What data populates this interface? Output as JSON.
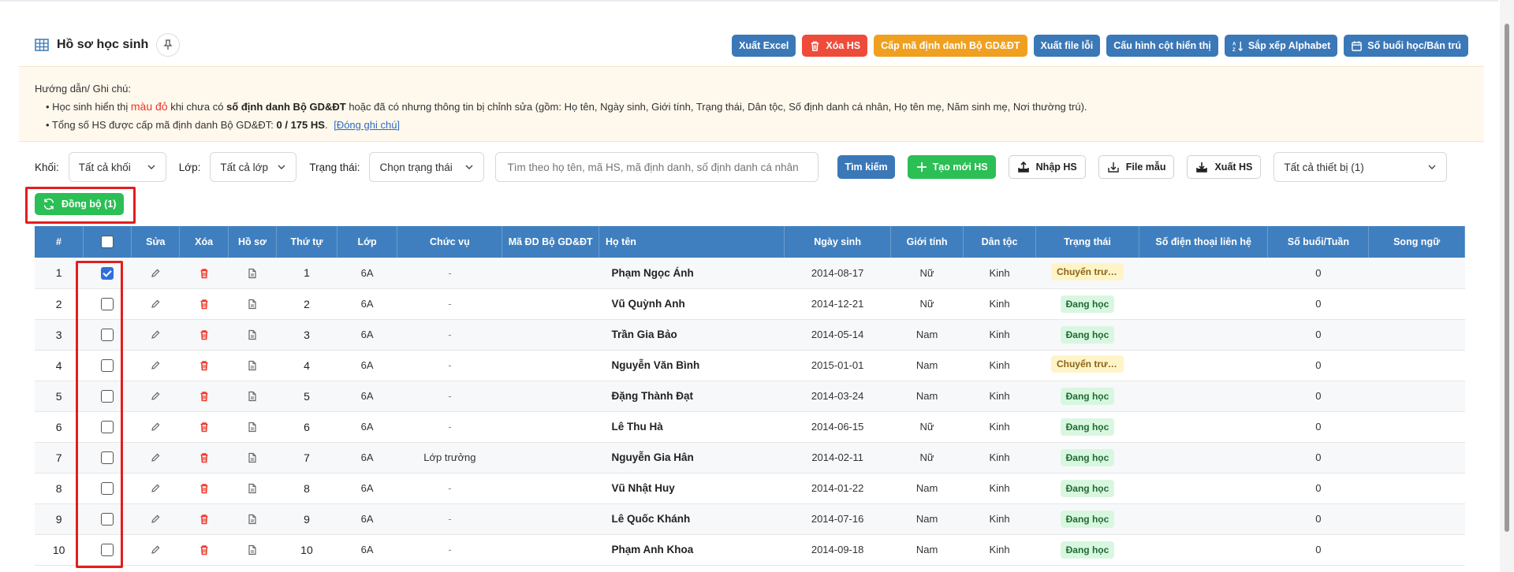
{
  "header": {
    "title": "Hồ sơ học sinh"
  },
  "toolbar": {
    "export_excel": "Xuất Excel",
    "delete_hs": "Xóa HS",
    "issue_id": "Cấp mã định danh Bộ GD&ĐT",
    "export_error_file": "Xuất file lỗi",
    "column_config": "Cấu hình cột hiển thị",
    "sort_alpha": "Sắp xếp Alphabet",
    "sessions": "Số buổi học/Bán trú"
  },
  "notes": {
    "heading": "Hướng dẫn/ Ghi chú:",
    "line1_a": "• Học sinh hiển thị ",
    "line1_red": "màu đỏ",
    "line1_b": " khi chưa có ",
    "line1_bold": "số định danh Bộ GD&ĐT",
    "line1_c": " hoặc đã có nhưng thông tin bị chỉnh sửa (gồm: Họ tên, Ngày sinh, Giới tính, Trạng thái, Dân tộc, Số định danh cá nhân, Họ tên mẹ, Năm sinh mẹ, Nơi thường trú).",
    "line2_a": "• Tổng số HS được cấp mã định danh Bộ GD&ĐT: ",
    "line2_bold": "0 / 175 HS",
    "line2_b": ".",
    "close_link": "[Đóng ghi chú]"
  },
  "filters": {
    "grade_label": "Khối:",
    "grade_value": "Tất cả khối",
    "class_label": "Lớp:",
    "class_value": "Tất cả lớp",
    "status_label": "Trạng thái:",
    "status_value": "Chọn trạng thái",
    "search_placeholder": "Tìm theo họ tên, mã HS, mã định danh, số định danh cá nhân",
    "search_button": "Tìm kiếm",
    "create_button": "Tạo mới HS",
    "import_button": "Nhập HS",
    "template_button": "File mẫu",
    "export_button": "Xuất HS",
    "device_value": "Tất cả thiết bị (1)"
  },
  "sync": {
    "label": "Đồng bộ (1)"
  },
  "table": {
    "headers": [
      "#",
      "",
      "Sửa",
      "Xóa",
      "Hồ sơ",
      "Thứ tự",
      "Lớp",
      "Chức vụ",
      "Mã ĐD Bộ GD&ĐT",
      "Họ tên",
      "Ngày sinh",
      "Giới tính",
      "Dân tộc",
      "Trạng thái",
      "Số điện thoại liên hệ",
      "Số buổi/Tuần",
      "Song ngữ"
    ],
    "rows": [
      {
        "idx": "1",
        "checked": true,
        "order": "1",
        "class": "6A",
        "role": "-",
        "name": "Phạm Ngọc Ánh",
        "dob": "2014-08-17",
        "gender": "Nữ",
        "ethnic": "Kinh",
        "status": "Chuyển trườ...",
        "status_color": "yellow",
        "sessions": "0"
      },
      {
        "idx": "2",
        "checked": false,
        "order": "2",
        "class": "6A",
        "role": "-",
        "name": "Vũ Quỳnh Anh",
        "dob": "2014-12-21",
        "gender": "Nữ",
        "ethnic": "Kinh",
        "status": "Đang học",
        "status_color": "green",
        "sessions": "0"
      },
      {
        "idx": "3",
        "checked": false,
        "order": "3",
        "class": "6A",
        "role": "-",
        "name": "Trần Gia Bảo",
        "dob": "2014-05-14",
        "gender": "Nam",
        "ethnic": "Kinh",
        "status": "Đang học",
        "status_color": "green",
        "sessions": "0"
      },
      {
        "idx": "4",
        "checked": false,
        "order": "4",
        "class": "6A",
        "role": "-",
        "name": "Nguyễn Văn Bình",
        "dob": "2015-01-01",
        "gender": "Nam",
        "ethnic": "Kinh",
        "status": "Chuyển trườ...",
        "status_color": "yellow",
        "sessions": "0"
      },
      {
        "idx": "5",
        "checked": false,
        "order": "5",
        "class": "6A",
        "role": "-",
        "name": "Đặng Thành Đạt",
        "dob": "2014-03-24",
        "gender": "Nam",
        "ethnic": "Kinh",
        "status": "Đang học",
        "status_color": "green",
        "sessions": "0"
      },
      {
        "idx": "6",
        "checked": false,
        "order": "6",
        "class": "6A",
        "role": "-",
        "name": "Lê Thu Hà",
        "dob": "2014-06-15",
        "gender": "Nữ",
        "ethnic": "Kinh",
        "status": "Đang học",
        "status_color": "green",
        "sessions": "0"
      },
      {
        "idx": "7",
        "checked": false,
        "order": "7",
        "class": "6A",
        "role": "Lớp trưởng",
        "name": "Nguyễn Gia Hân",
        "dob": "2014-02-11",
        "gender": "Nữ",
        "ethnic": "Kinh",
        "status": "Đang học",
        "status_color": "green",
        "sessions": "0"
      },
      {
        "idx": "8",
        "checked": false,
        "order": "8",
        "class": "6A",
        "role": "-",
        "name": "Vũ Nhật Huy",
        "dob": "2014-01-22",
        "gender": "Nam",
        "ethnic": "Kinh",
        "status": "Đang học",
        "status_color": "green",
        "sessions": "0"
      },
      {
        "idx": "9",
        "checked": false,
        "order": "9",
        "class": "6A",
        "role": "-",
        "name": "Lê Quốc Khánh",
        "dob": "2014-07-16",
        "gender": "Nam",
        "ethnic": "Kinh",
        "status": "Đang học",
        "status_color": "green",
        "sessions": "0"
      },
      {
        "idx": "10",
        "checked": false,
        "order": "10",
        "class": "6A",
        "role": "-",
        "name": "Phạm Anh Khoa",
        "dob": "2014-09-18",
        "gender": "Nam",
        "ethnic": "Kinh",
        "status": "Đang học",
        "status_color": "green",
        "sessions": "0"
      }
    ]
  }
}
